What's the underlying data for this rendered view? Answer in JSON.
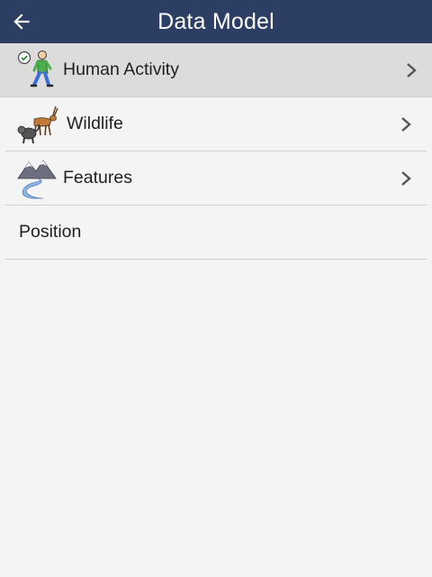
{
  "app_bar": {
    "title": "Data Model",
    "back_icon": "arrow-left-icon"
  },
  "list": {
    "items": [
      {
        "label": "Human Activity",
        "icon": "hiker-icon",
        "selected": true,
        "has_children": true
      },
      {
        "label": "Wildlife",
        "icon": "wildlife-icon",
        "selected": false,
        "has_children": true
      },
      {
        "label": "Features",
        "icon": "mountain-river-icon",
        "selected": false,
        "has_children": true
      },
      {
        "label": "Position",
        "icon": "",
        "selected": false,
        "has_children": false
      }
    ]
  },
  "colors": {
    "app_bar": "#2c3e63",
    "background": "#f4f4f4",
    "selected_row": "#dcdcdc"
  }
}
